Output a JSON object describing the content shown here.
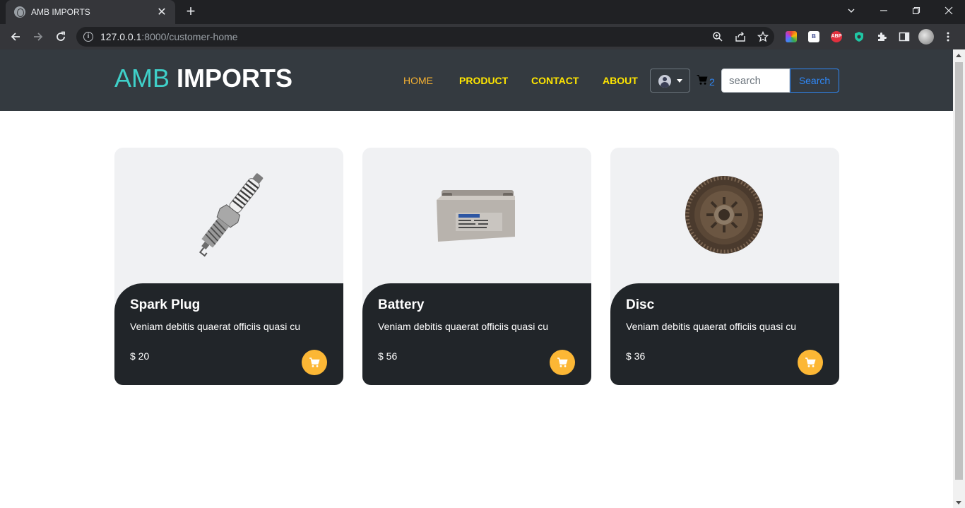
{
  "browser": {
    "tab_title": "AMB IMPORTS",
    "url_host": "127.0.0.1",
    "url_rest": ":8000/customer-home",
    "extension_b_label": "B",
    "extension_abp_label": "ABP"
  },
  "header": {
    "brand_part1": "AMB",
    "brand_part2": "IMPORTS",
    "nav": {
      "home": "HOME",
      "product": "PRODUCT",
      "contact": "CONTACT",
      "about": "ABOUT"
    },
    "cart_count": "2",
    "search_placeholder": "search",
    "search_button": "Search"
  },
  "products": [
    {
      "name": "Spark Plug",
      "description": "Veniam debitis quaerat officiis quasi cu",
      "price": "$ 20"
    },
    {
      "name": "Battery",
      "description": "Veniam debitis quaerat officiis quasi cu",
      "price": "$ 56"
    },
    {
      "name": "Disc",
      "description": "Veniam debitis quaerat officiis quasi cu",
      "price": "$ 36"
    }
  ],
  "colors": {
    "header_bg": "#343a40",
    "brand_accent": "#3fd0c9",
    "nav_yellow": "#ffe600",
    "nav_active": "#f5b132",
    "card_dark": "#212529",
    "cart_button": "#fcb735",
    "link_blue": "#2f87f5"
  }
}
